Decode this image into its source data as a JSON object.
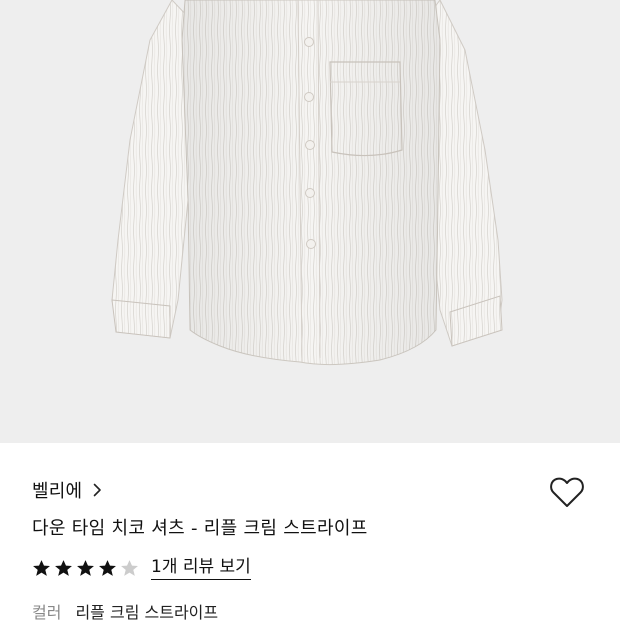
{
  "product": {
    "brand": "벨리에",
    "title": "다운 타임 치코 셔츠 - 리플 크림 스트라이프",
    "rating": 4,
    "rating_max": 5,
    "review_link": "1개 리뷰 보기",
    "color_label": "컬러",
    "color_value": "리플 크림 스트라이프"
  },
  "icons": {
    "brand_arrow": "chevron-right-icon",
    "wishlist": "heart-outline-icon",
    "star_filled": "star-filled-icon",
    "star_empty": "star-empty-icon"
  },
  "colors": {
    "image_background": "#eeeeee",
    "star_filled": "#111111",
    "star_empty": "#cccccc",
    "label_gray": "#888888"
  }
}
